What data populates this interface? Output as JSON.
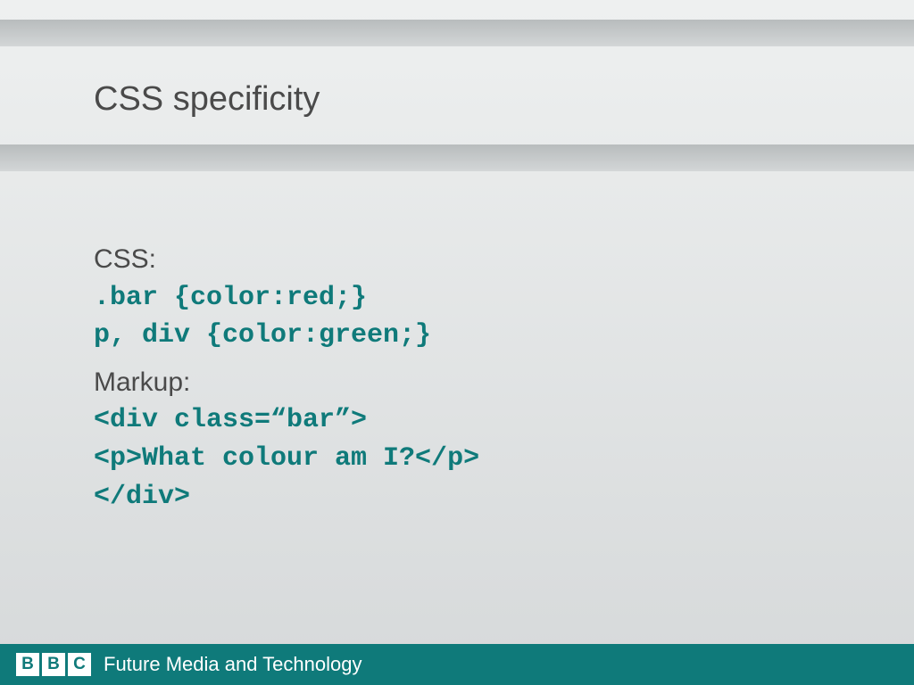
{
  "title": "CSS specificity",
  "content": {
    "css_label": "CSS:",
    "css_line1": ".bar {color:red;}",
    "css_line2": "p, div {color:green;}",
    "markup_label": "Markup:",
    "markup_line1": "<div class=“bar”>",
    "markup_line2": "<p>What colour am I?</p>",
    "markup_line3": "</div>"
  },
  "footer": {
    "logo": {
      "b1": "B",
      "b2": "B",
      "c": "C"
    },
    "text": "Future Media and Technology"
  }
}
